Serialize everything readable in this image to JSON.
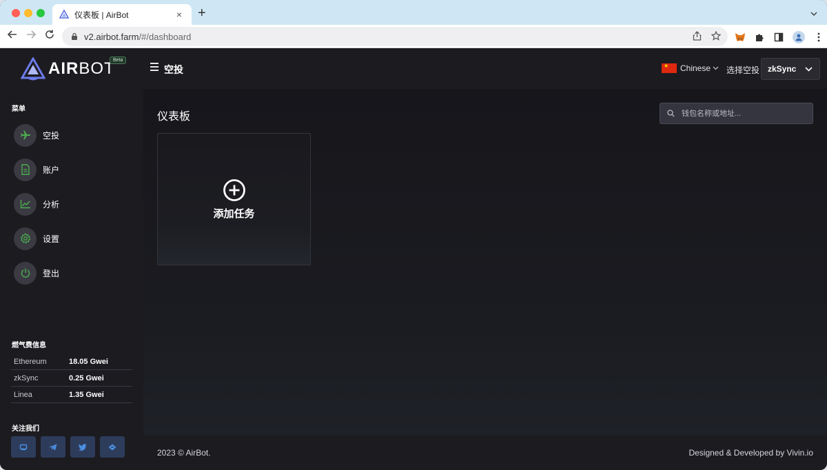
{
  "browser": {
    "tab_title": "仪表板 | AirBot",
    "url_host": "v2.airbot.farm",
    "url_path": "/#/dashboard",
    "new_tab": "+",
    "tab_close": "×"
  },
  "sidebar": {
    "logo_text_bold": "AIR",
    "logo_text": "BOT",
    "beta": "Beta",
    "menu_title": "菜单",
    "items": [
      {
        "label": "空投",
        "icon": "plane-icon"
      },
      {
        "label": "账户",
        "icon": "document-icon"
      },
      {
        "label": "分析",
        "icon": "chart-icon"
      },
      {
        "label": "设置",
        "icon": "gear-icon"
      },
      {
        "label": "登出",
        "icon": "power-icon"
      }
    ],
    "gas_title": "燃气费信息",
    "gas": [
      {
        "name": "Ethereum",
        "value": "18.05 Gwei"
      },
      {
        "name": "zkSync",
        "value": "0.25 Gwei"
      },
      {
        "name": "Linea",
        "value": "1.35 Gwei"
      }
    ],
    "follow_title": "关注我们",
    "socials": [
      "discord-icon",
      "telegram-icon",
      "twitter-icon",
      "gitbook-icon"
    ]
  },
  "topbar": {
    "title": "空投",
    "language": "Chinese",
    "select_label": "选择空投",
    "selected_airdrop": "zkSync"
  },
  "main": {
    "page_title": "仪表板",
    "search_placeholder": "钱包名称或地址...",
    "add_task_label": "添加任务"
  },
  "footer": {
    "copyright": "2023 © AirBot.",
    "credits": "Designed & Developed by Vivin.io"
  },
  "colors": {
    "accent_green": "#4caf50",
    "sidebar_bg": "#1c1b20",
    "main_bg": "#17161b",
    "social_bg": "#2e3c5b"
  }
}
